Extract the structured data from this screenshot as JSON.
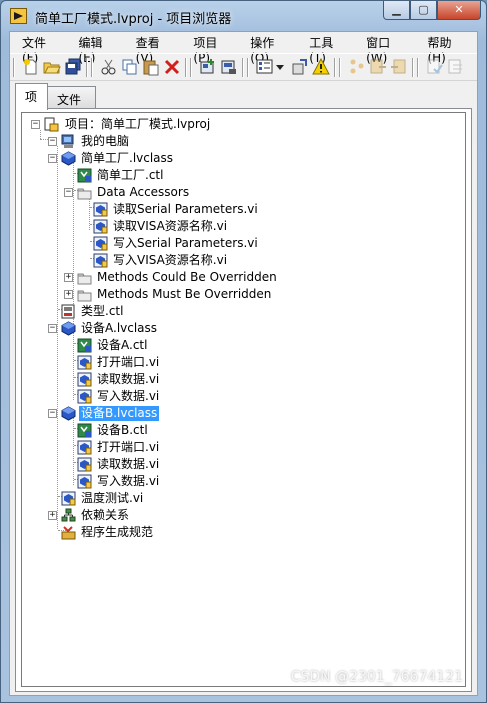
{
  "window": {
    "title": "简单工厂模式.lvproj - 项目浏览器"
  },
  "menu": [
    "文件(F)",
    "编辑(E)",
    "查看(V)",
    "项目(P)",
    "操作(O)",
    "工具(T)",
    "窗口(W)",
    "帮助(H)"
  ],
  "tabs": [
    {
      "label": "项",
      "active": true
    },
    {
      "label": "文件",
      "active": false
    }
  ],
  "tree": {
    "root": "项目：简单工厂模式.lvproj",
    "computer": "我的电脑",
    "items": [
      {
        "label": "简单工厂.lvclass",
        "icon": "lvclass-icon"
      },
      {
        "label": "简单工厂.ctl",
        "icon": "class-ctl-icon"
      },
      {
        "label": "Data Accessors",
        "icon": "folder-icon"
      },
      {
        "label": "读取Serial Parameters.vi",
        "icon": "vi-icon"
      },
      {
        "label": "读取VISA资源名称.vi",
        "icon": "vi-icon"
      },
      {
        "label": "写入Serial Parameters.vi",
        "icon": "vi-icon"
      },
      {
        "label": "写入VISA资源名称.vi",
        "icon": "vi-icon"
      },
      {
        "label": "Methods Could Be Overridden",
        "icon": "folder-icon"
      },
      {
        "label": "Methods Must Be Overridden",
        "icon": "folder-icon"
      },
      {
        "label": "类型.ctl",
        "icon": "typedef-ctl-icon"
      },
      {
        "label": "设备A.lvclass",
        "icon": "lvclass-icon"
      },
      {
        "label": "设备A.ctl",
        "icon": "class-ctl-icon"
      },
      {
        "label": "打开端口.vi",
        "icon": "vi-icon"
      },
      {
        "label": "读取数据.vi",
        "icon": "vi-icon"
      },
      {
        "label": "写入数据.vi",
        "icon": "vi-icon"
      },
      {
        "label": "设备B.lvclass",
        "icon": "lvclass-icon",
        "selected": true
      },
      {
        "label": "设备B.ctl",
        "icon": "class-ctl-icon"
      },
      {
        "label": "打开端口.vi",
        "icon": "vi-icon"
      },
      {
        "label": "读取数据.vi",
        "icon": "vi-icon"
      },
      {
        "label": "写入数据.vi",
        "icon": "vi-icon"
      },
      {
        "label": "温度测试.vi",
        "icon": "vi-icon"
      },
      {
        "label": "依赖关系",
        "icon": "dependencies-icon"
      },
      {
        "label": "程序生成规范",
        "icon": "build-specs-icon"
      }
    ]
  },
  "watermark": "CSDN @2301_76674121"
}
